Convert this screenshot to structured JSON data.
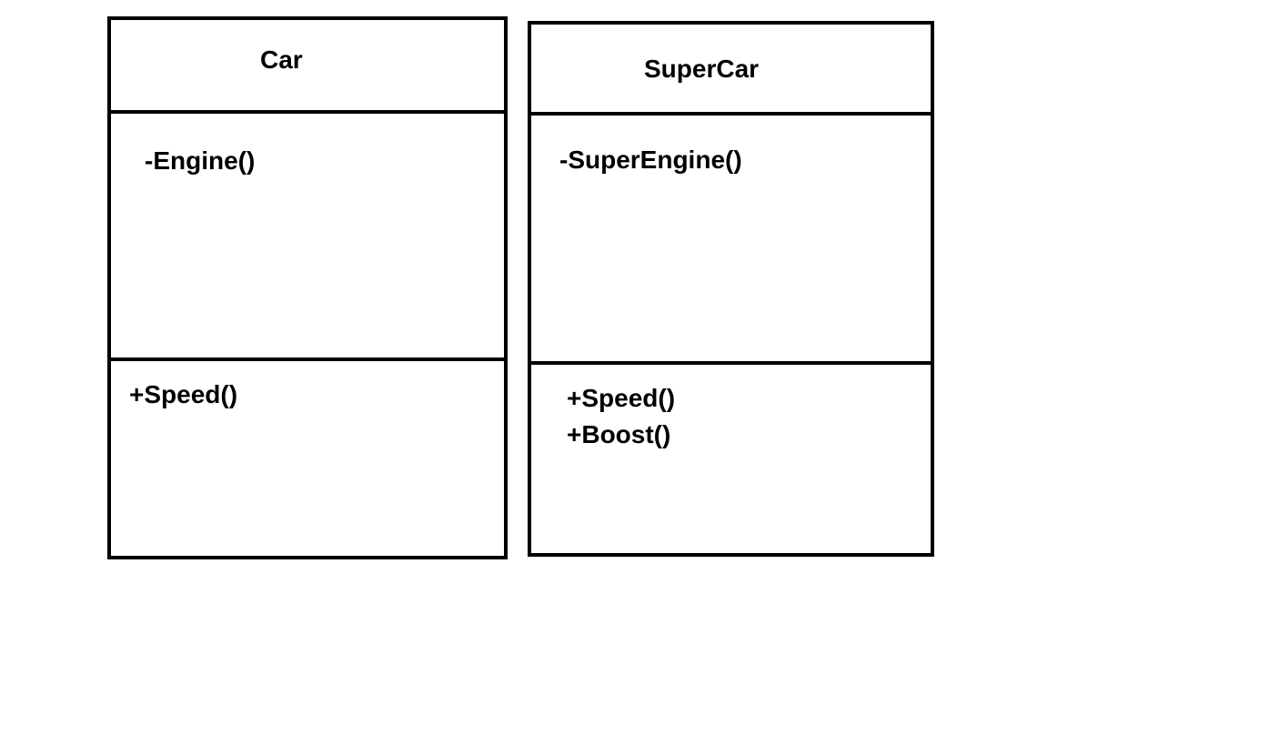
{
  "classes": [
    {
      "name": "Car",
      "attributes": [
        "-Engine()"
      ],
      "operations": [
        "+Speed()"
      ]
    },
    {
      "name": "SuperCar",
      "attributes": [
        "-SuperEngine()"
      ],
      "operations": [
        "+Speed()",
        "+Boost()"
      ]
    }
  ]
}
